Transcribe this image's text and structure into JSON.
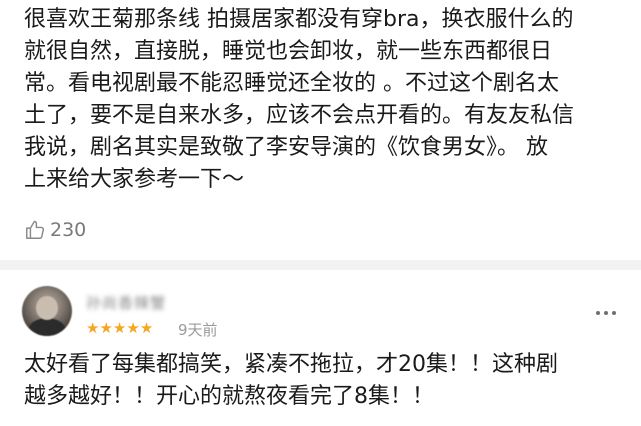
{
  "top_review": {
    "lines": [
      "很喜欢王菊那条线 拍摄居家都没有穿bra，换衣服什么的",
      "就很自然，直接脱，睡觉也会卸妆，就一些东西都很日",
      "常。看电视剧最不能忍睡觉还全妆的 。不过这个剧名太",
      "土了，要不是自来水多，应该不会点开看的。有友友私信",
      "我说，剧名其实是致敬了李安导演的《饮食男女》。 放",
      "上来给大家参考一下～"
    ],
    "like_count": "230",
    "like_icon": "thumbs-up-icon"
  },
  "comment": {
    "username": "孙尚香辣蟹",
    "rating_stars": 5,
    "rating_max": 5,
    "time_ago": "9天前",
    "more_icon": "more-dots-icon",
    "lines": [
      "太好看了每集都搞笑，紧凑不拖拉，才20集！！这种剧",
      "越多越好！！开心的就熬夜看完了8集！！"
    ]
  },
  "colors": {
    "text": "#1a1a1a",
    "meta": "#9b9b9b",
    "star": "#f5a623",
    "divider": "#f2f2f2"
  }
}
